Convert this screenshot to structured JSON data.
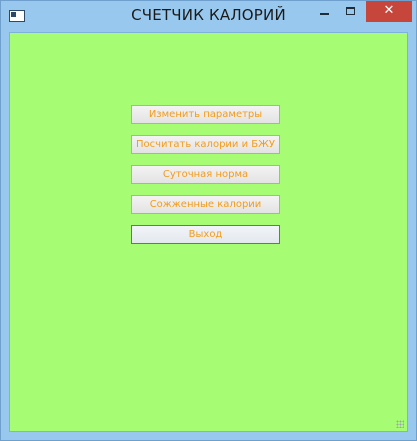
{
  "window": {
    "title": "СЧЕТЧИК КАЛОРИЙ",
    "controls": {
      "minimize": "–",
      "maximize": "□",
      "close": "✕"
    }
  },
  "menu": {
    "buttons": [
      "Изменить параметры",
      "Посчитать калории и БЖУ",
      "Суточная норма",
      "Сожженные калории",
      "Выход"
    ]
  },
  "colors": {
    "background": "#a6fc72",
    "button_text": "#f49b1a",
    "close_button": "#c7463b"
  }
}
